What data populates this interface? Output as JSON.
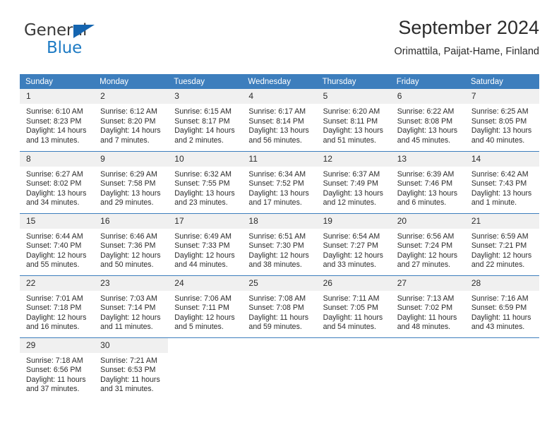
{
  "brand": {
    "name_top": "General",
    "name_bottom": "Blue",
    "triangle_color": "#1565b0",
    "blue_color": "#1e7bc4"
  },
  "header": {
    "title": "September 2024",
    "subtitle": "Orimattila, Paijat-Hame, Finland"
  },
  "theme": {
    "header_blue": "#3d7ebd",
    "daynum_bg": "#f0f0f0",
    "text": "#2b2b2b"
  },
  "weekday_headers": [
    "Sunday",
    "Monday",
    "Tuesday",
    "Wednesday",
    "Thursday",
    "Friday",
    "Saturday"
  ],
  "weeks": [
    [
      {
        "day": "1",
        "sunrise": "Sunrise: 6:10 AM",
        "sunset": "Sunset: 8:23 PM",
        "daylight": "Daylight: 14 hours and 13 minutes."
      },
      {
        "day": "2",
        "sunrise": "Sunrise: 6:12 AM",
        "sunset": "Sunset: 8:20 PM",
        "daylight": "Daylight: 14 hours and 7 minutes."
      },
      {
        "day": "3",
        "sunrise": "Sunrise: 6:15 AM",
        "sunset": "Sunset: 8:17 PM",
        "daylight": "Daylight: 14 hours and 2 minutes."
      },
      {
        "day": "4",
        "sunrise": "Sunrise: 6:17 AM",
        "sunset": "Sunset: 8:14 PM",
        "daylight": "Daylight: 13 hours and 56 minutes."
      },
      {
        "day": "5",
        "sunrise": "Sunrise: 6:20 AM",
        "sunset": "Sunset: 8:11 PM",
        "daylight": "Daylight: 13 hours and 51 minutes."
      },
      {
        "day": "6",
        "sunrise": "Sunrise: 6:22 AM",
        "sunset": "Sunset: 8:08 PM",
        "daylight": "Daylight: 13 hours and 45 minutes."
      },
      {
        "day": "7",
        "sunrise": "Sunrise: 6:25 AM",
        "sunset": "Sunset: 8:05 PM",
        "daylight": "Daylight: 13 hours and 40 minutes."
      }
    ],
    [
      {
        "day": "8",
        "sunrise": "Sunrise: 6:27 AM",
        "sunset": "Sunset: 8:02 PM",
        "daylight": "Daylight: 13 hours and 34 minutes."
      },
      {
        "day": "9",
        "sunrise": "Sunrise: 6:29 AM",
        "sunset": "Sunset: 7:58 PM",
        "daylight": "Daylight: 13 hours and 29 minutes."
      },
      {
        "day": "10",
        "sunrise": "Sunrise: 6:32 AM",
        "sunset": "Sunset: 7:55 PM",
        "daylight": "Daylight: 13 hours and 23 minutes."
      },
      {
        "day": "11",
        "sunrise": "Sunrise: 6:34 AM",
        "sunset": "Sunset: 7:52 PM",
        "daylight": "Daylight: 13 hours and 17 minutes."
      },
      {
        "day": "12",
        "sunrise": "Sunrise: 6:37 AM",
        "sunset": "Sunset: 7:49 PM",
        "daylight": "Daylight: 13 hours and 12 minutes."
      },
      {
        "day": "13",
        "sunrise": "Sunrise: 6:39 AM",
        "sunset": "Sunset: 7:46 PM",
        "daylight": "Daylight: 13 hours and 6 minutes."
      },
      {
        "day": "14",
        "sunrise": "Sunrise: 6:42 AM",
        "sunset": "Sunset: 7:43 PM",
        "daylight": "Daylight: 13 hours and 1 minute."
      }
    ],
    [
      {
        "day": "15",
        "sunrise": "Sunrise: 6:44 AM",
        "sunset": "Sunset: 7:40 PM",
        "daylight": "Daylight: 12 hours and 55 minutes."
      },
      {
        "day": "16",
        "sunrise": "Sunrise: 6:46 AM",
        "sunset": "Sunset: 7:36 PM",
        "daylight": "Daylight: 12 hours and 50 minutes."
      },
      {
        "day": "17",
        "sunrise": "Sunrise: 6:49 AM",
        "sunset": "Sunset: 7:33 PM",
        "daylight": "Daylight: 12 hours and 44 minutes."
      },
      {
        "day": "18",
        "sunrise": "Sunrise: 6:51 AM",
        "sunset": "Sunset: 7:30 PM",
        "daylight": "Daylight: 12 hours and 38 minutes."
      },
      {
        "day": "19",
        "sunrise": "Sunrise: 6:54 AM",
        "sunset": "Sunset: 7:27 PM",
        "daylight": "Daylight: 12 hours and 33 minutes."
      },
      {
        "day": "20",
        "sunrise": "Sunrise: 6:56 AM",
        "sunset": "Sunset: 7:24 PM",
        "daylight": "Daylight: 12 hours and 27 minutes."
      },
      {
        "day": "21",
        "sunrise": "Sunrise: 6:59 AM",
        "sunset": "Sunset: 7:21 PM",
        "daylight": "Daylight: 12 hours and 22 minutes."
      }
    ],
    [
      {
        "day": "22",
        "sunrise": "Sunrise: 7:01 AM",
        "sunset": "Sunset: 7:18 PM",
        "daylight": "Daylight: 12 hours and 16 minutes."
      },
      {
        "day": "23",
        "sunrise": "Sunrise: 7:03 AM",
        "sunset": "Sunset: 7:14 PM",
        "daylight": "Daylight: 12 hours and 11 minutes."
      },
      {
        "day": "24",
        "sunrise": "Sunrise: 7:06 AM",
        "sunset": "Sunset: 7:11 PM",
        "daylight": "Daylight: 12 hours and 5 minutes."
      },
      {
        "day": "25",
        "sunrise": "Sunrise: 7:08 AM",
        "sunset": "Sunset: 7:08 PM",
        "daylight": "Daylight: 11 hours and 59 minutes."
      },
      {
        "day": "26",
        "sunrise": "Sunrise: 7:11 AM",
        "sunset": "Sunset: 7:05 PM",
        "daylight": "Daylight: 11 hours and 54 minutes."
      },
      {
        "day": "27",
        "sunrise": "Sunrise: 7:13 AM",
        "sunset": "Sunset: 7:02 PM",
        "daylight": "Daylight: 11 hours and 48 minutes."
      },
      {
        "day": "28",
        "sunrise": "Sunrise: 7:16 AM",
        "sunset": "Sunset: 6:59 PM",
        "daylight": "Daylight: 11 hours and 43 minutes."
      }
    ],
    [
      {
        "day": "29",
        "sunrise": "Sunrise: 7:18 AM",
        "sunset": "Sunset: 6:56 PM",
        "daylight": "Daylight: 11 hours and 37 minutes."
      },
      {
        "day": "30",
        "sunrise": "Sunrise: 7:21 AM",
        "sunset": "Sunset: 6:53 PM",
        "daylight": "Daylight: 11 hours and 31 minutes."
      },
      {
        "day": "",
        "sunrise": "",
        "sunset": "",
        "daylight": ""
      },
      {
        "day": "",
        "sunrise": "",
        "sunset": "",
        "daylight": ""
      },
      {
        "day": "",
        "sunrise": "",
        "sunset": "",
        "daylight": ""
      },
      {
        "day": "",
        "sunrise": "",
        "sunset": "",
        "daylight": ""
      },
      {
        "day": "",
        "sunrise": "",
        "sunset": "",
        "daylight": ""
      }
    ]
  ]
}
